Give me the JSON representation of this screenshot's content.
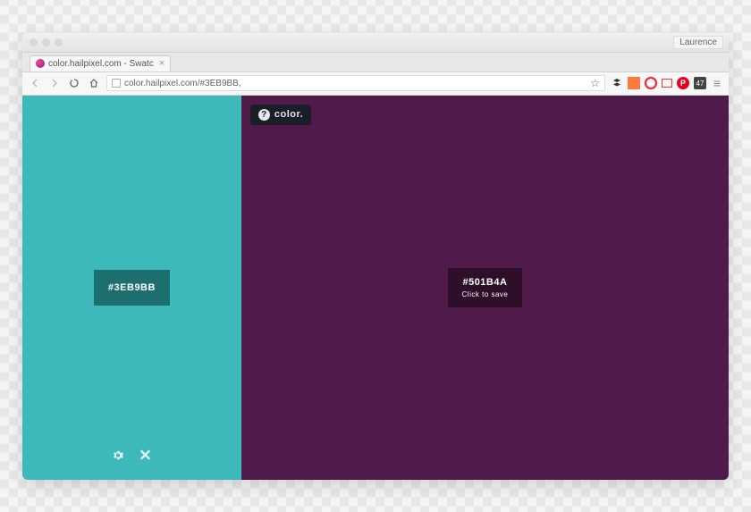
{
  "browser": {
    "profile_name": "Laurence",
    "tab": {
      "title": "color.hailpixel.com - Swatc"
    },
    "url": "color.hailpixel.com/#3EB9BB,",
    "extension_badge": "47"
  },
  "app": {
    "logo_text": "color."
  },
  "swatches": {
    "left": {
      "hex": "#3EB9BB",
      "bg_color": "#3EB9BB"
    },
    "right": {
      "hex": "#501B4A",
      "subtext": "Click to save",
      "bg_color": "#501B4A"
    }
  }
}
